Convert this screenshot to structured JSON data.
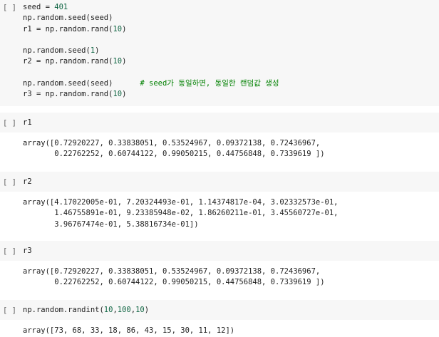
{
  "colors": {
    "cell_background": "#f7f7f7",
    "number": "#116644",
    "comment": "#008000",
    "text": "#212121"
  },
  "cells": [
    {
      "prompt": "[ ]",
      "lines": [
        [
          "seed = ",
          "401"
        ],
        [
          "np.random.seed(seed)"
        ],
        [
          "r1 = np.random.rand(",
          "10",
          ")"
        ],
        [
          ""
        ],
        [
          "np.random.seed(",
          "1",
          ")"
        ],
        [
          "r2 = np.random.rand(",
          "10",
          ")"
        ],
        [
          ""
        ],
        [
          "np.random.seed(seed)      ",
          "# seed가 동일하면, 동일한 랜덤값 생성"
        ],
        [
          "r3 = np.random.rand(",
          "10",
          ")"
        ]
      ]
    },
    {
      "prompt": "[ ]",
      "code": "r1",
      "output": "array([0.72920227, 0.33838051, 0.53524967, 0.09372138, 0.72436967,\n       0.22762252, 0.60744122, 0.99050215, 0.44756848, 0.7339619 ])"
    },
    {
      "prompt": "[ ]",
      "code": "r2",
      "output": "array([4.17022005e-01, 7.20324493e-01, 1.14374817e-04, 3.02332573e-01,\n       1.46755891e-01, 9.23385948e-02, 1.86260211e-01, 3.45560727e-01,\n       3.96767474e-01, 5.38816734e-01])"
    },
    {
      "prompt": "[ ]",
      "code": "r3",
      "output": "array([0.72920227, 0.33838051, 0.53524967, 0.09372138, 0.72436967,\n       0.22762252, 0.60744122, 0.99050215, 0.44756848, 0.7339619 ])"
    },
    {
      "prompt": "[ ]",
      "code_parts": [
        "np.random.randint(",
        "10",
        ",",
        "100",
        ",",
        "10",
        ")"
      ],
      "output": "array([73, 68, 33, 18, 86, 43, 15, 30, 11, 12])"
    }
  ]
}
